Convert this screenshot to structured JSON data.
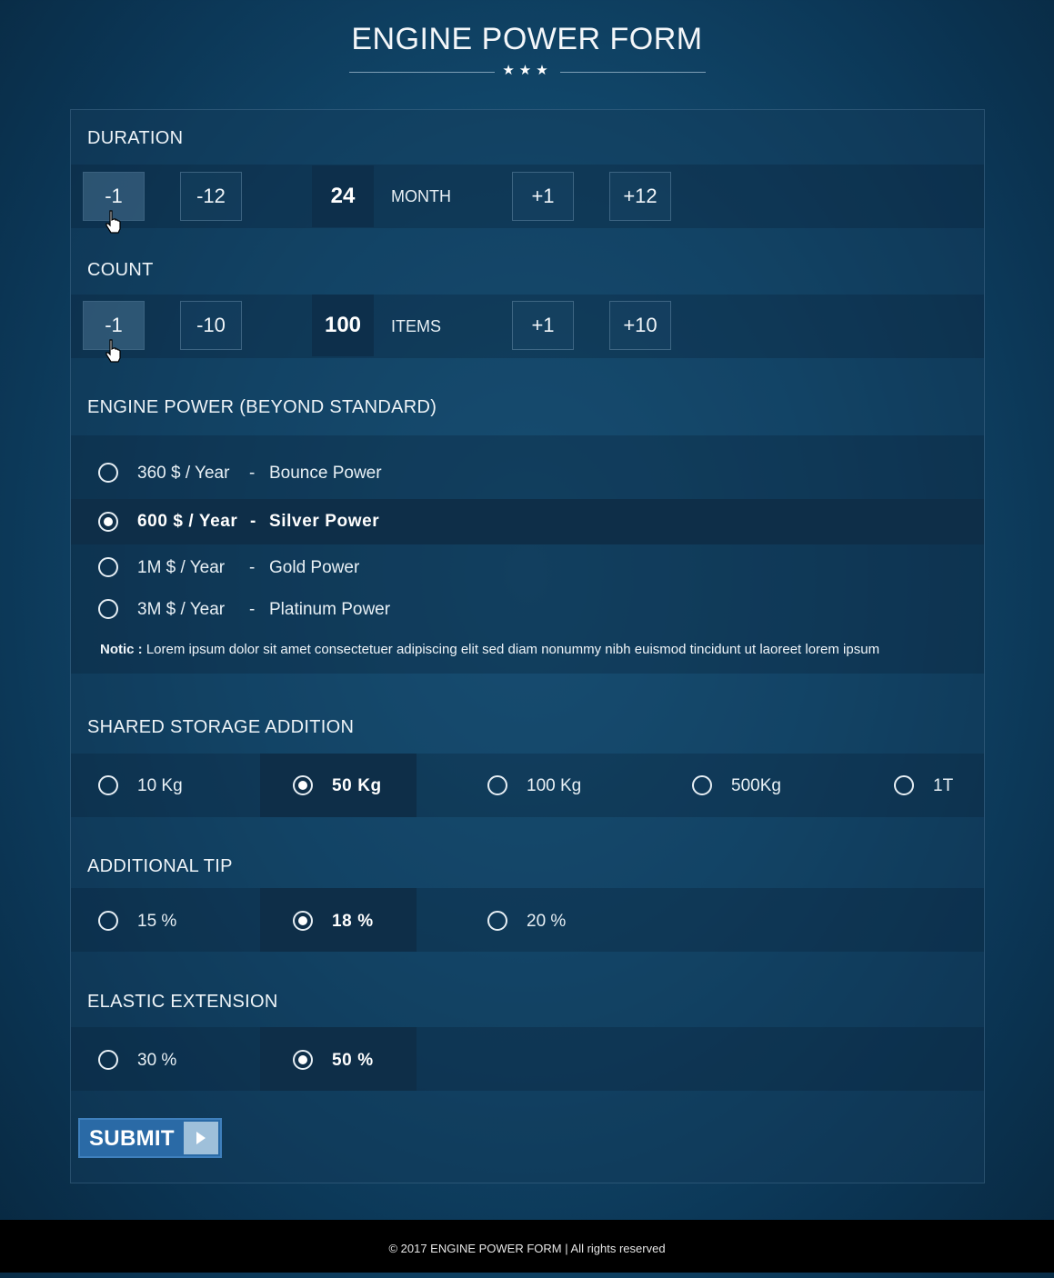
{
  "title": "ENGINE POWER FORM",
  "stars": "★★★",
  "duration": {
    "heading": "DURATION",
    "minus_small": "-1",
    "minus_large": "-12",
    "value": "24",
    "unit": "MONTH",
    "plus_small": "+1",
    "plus_large": "+12"
  },
  "count": {
    "heading": "COUNT",
    "minus_small": "-1",
    "minus_large": "-10",
    "value": "100",
    "unit": "ITEMS",
    "plus_small": "+1",
    "plus_large": "+10"
  },
  "engine_power": {
    "heading": "ENGINE POWER (BEYOND STANDARD)",
    "options": [
      {
        "price": "360 $ / Year",
        "sep": "-",
        "name": "Bounce Power",
        "selected": false
      },
      {
        "price": "600 $ / Year",
        "sep": "-",
        "name": "Silver Power",
        "selected": true
      },
      {
        "price": "1M $ / Year",
        "sep": "-",
        "name": "Gold Power",
        "selected": false
      },
      {
        "price": "3M $ / Year",
        "sep": "-",
        "name": "Platinum Power",
        "selected": false
      }
    ],
    "notice_label": "Notic :",
    "notice_text": "Lorem ipsum dolor sit amet consectetuer adipiscing elit sed diam nonummy nibh euismod tincidunt ut laoreet lorem ipsum"
  },
  "storage": {
    "heading": "SHARED STORAGE ADDITION",
    "options": [
      {
        "label": "10 Kg",
        "selected": false
      },
      {
        "label": "50 Kg",
        "selected": true
      },
      {
        "label": "100 Kg",
        "selected": false
      },
      {
        "label": "500Kg",
        "selected": false
      },
      {
        "label": "1T",
        "selected": false
      }
    ]
  },
  "tip": {
    "heading": "ADDITIONAL TIP",
    "options": [
      {
        "label": "15 %",
        "selected": false
      },
      {
        "label": "18 %",
        "selected": true
      },
      {
        "label": "20 %",
        "selected": false
      }
    ]
  },
  "elastic": {
    "heading": "ELASTIC EXTENSION",
    "options": [
      {
        "label": "30 %",
        "selected": false
      },
      {
        "label": "50 %",
        "selected": true
      }
    ]
  },
  "submit_label": "SUBMIT",
  "footer": "© 2017 ENGINE POWER FORM  |  All rights reserved"
}
